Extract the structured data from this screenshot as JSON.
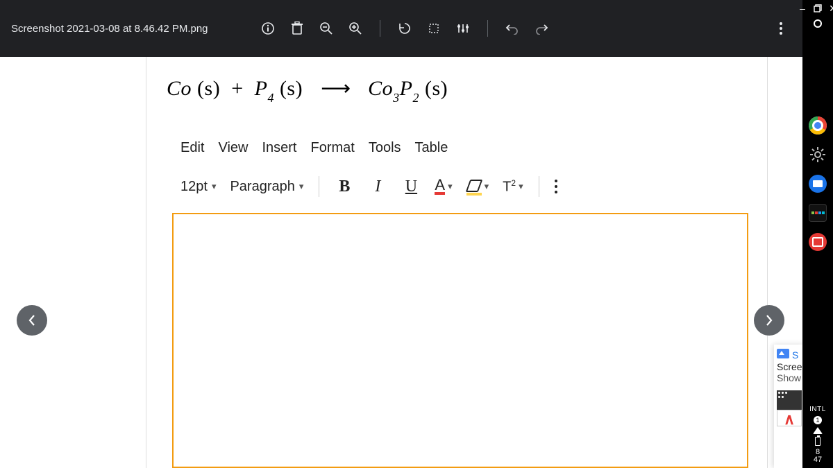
{
  "header": {
    "filename": "Screenshot 2021-03-08 at 8.46.42 PM.png"
  },
  "equation": {
    "lhs_1": "Co",
    "lhs_1_state": "(s)",
    "plus": "+",
    "lhs_2_base": "P",
    "lhs_2_sub": "4",
    "lhs_2_state": "(s)",
    "arrow": "⟶",
    "rhs_base1": "Co",
    "rhs_sub1": "3",
    "rhs_base2": "P",
    "rhs_sub2": "2",
    "rhs_state": "(s)"
  },
  "menus": [
    "Edit",
    "View",
    "Insert",
    "Format",
    "Tools",
    "Table"
  ],
  "toolbar": {
    "font_size": "12pt",
    "paragraph": "Paragraph",
    "bold": "B",
    "italic": "I",
    "underline": "U",
    "textcolor_letter": "A",
    "superscript": "T²"
  },
  "preview": {
    "title_letter": "S",
    "line1": "Scree",
    "line2": "Show"
  },
  "shelf": {
    "intl": "INTL",
    "badge": "1",
    "clock_h": "8",
    "clock_m": "47"
  }
}
